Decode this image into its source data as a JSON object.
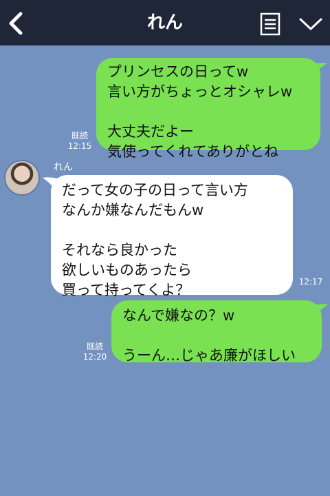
{
  "header": {
    "title": "れん"
  },
  "messages": [
    {
      "side": "right",
      "text": "プリンセスの日ってw\n言い方がちょっとオシャレw\n\n大丈夫だよー\n気使ってくれてありがとね",
      "read": "既読",
      "time": "12:15"
    },
    {
      "side": "left",
      "sender": "れん",
      "text": "だって女の子の日って言い方\nなんか嫌なんだもんw\n\nそれなら良かった\n欲しいものあったら\n買って持ってくよ？",
      "time": "12:17"
    },
    {
      "side": "right",
      "text": "なんで嫌なの？w\n\nうーん…じゃあ廉がほしい",
      "read": "既読",
      "time": "12:20"
    }
  ],
  "colors": {
    "header_bg": "#1f2638",
    "chat_bg": "#7492c0",
    "sent_bubble": "#79e152",
    "received_bubble": "#ffffff"
  },
  "icons": [
    "back-arrow-icon",
    "memo-icon",
    "chevron-down-icon"
  ]
}
